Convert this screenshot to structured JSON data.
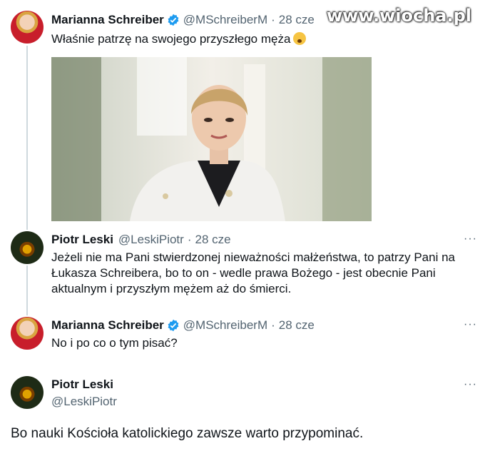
{
  "watermark": "www.wiocha.pl",
  "tweets": [
    {
      "author": "Marianna Schreiber",
      "handle": "@MSchreiberM",
      "separator": "·",
      "date": "28 cze",
      "text": "Właśnie patrzę na swojego przyszłego męża",
      "more": "···",
      "emoji": "hushed-face"
    },
    {
      "author": "Piotr Leski",
      "handle": "@LeskiPiotr",
      "separator": "·",
      "date": "28 cze",
      "text": "Jeżeli nie ma Pani stwierdzonej nieważności małżeństwa, to patrzy Pani na Łukasza Schreibera, bo to on - wedle prawa Bożego - jest obecnie Pani aktualnym i przyszłym mężem aż do śmierci.",
      "more": "···"
    },
    {
      "author": "Marianna Schreiber",
      "handle": "@MSchreiberM",
      "separator": "·",
      "date": "28 cze",
      "text": "No i po co o tym pisać?",
      "more": "···"
    },
    {
      "author": "Piotr Leski",
      "handle": "@LeskiPiotr",
      "text": "Bo nauki Kościoła katolickiego zawsze warto przypominać.",
      "more": "···"
    }
  ],
  "colors": {
    "verified": "#1d9bf0",
    "secondary_text": "#536471",
    "thread_line": "#cfd9de"
  }
}
